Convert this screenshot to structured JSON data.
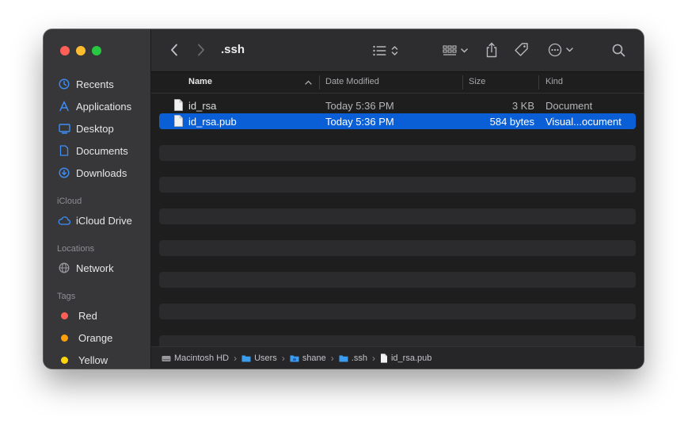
{
  "window": {
    "title": ".ssh"
  },
  "sidebar": {
    "favorites": [
      {
        "label": "Recents",
        "icon": "clock-icon"
      },
      {
        "label": "Applications",
        "icon": "applications-icon"
      },
      {
        "label": "Desktop",
        "icon": "desktop-icon"
      },
      {
        "label": "Documents",
        "icon": "document-icon"
      },
      {
        "label": "Downloads",
        "icon": "download-icon"
      }
    ],
    "icloud_header": "iCloud",
    "icloud_drive": "iCloud Drive",
    "locations_header": "Locations",
    "network": "Network",
    "tags_header": "Tags",
    "tags": [
      {
        "label": "Red",
        "color": "#ff5f57"
      },
      {
        "label": "Orange",
        "color": "#ff9f0a"
      },
      {
        "label": "Yellow",
        "color": "#ffd60a"
      }
    ]
  },
  "columns": {
    "name": "Name",
    "date": "Date Modified",
    "size": "Size",
    "kind": "Kind"
  },
  "files": [
    {
      "name": "id_rsa",
      "date": "Today 5:36 PM",
      "size": "3 KB",
      "kind": "Document",
      "selected": false
    },
    {
      "name": "id_rsa.pub",
      "date": "Today 5:36 PM",
      "size": "584 bytes",
      "kind": "Visual...ocument",
      "selected": true
    }
  ],
  "pathbar": [
    "Macintosh HD",
    "Users",
    "shane",
    ".ssh",
    "id_rsa.pub"
  ],
  "accent": "#0a5fd6"
}
